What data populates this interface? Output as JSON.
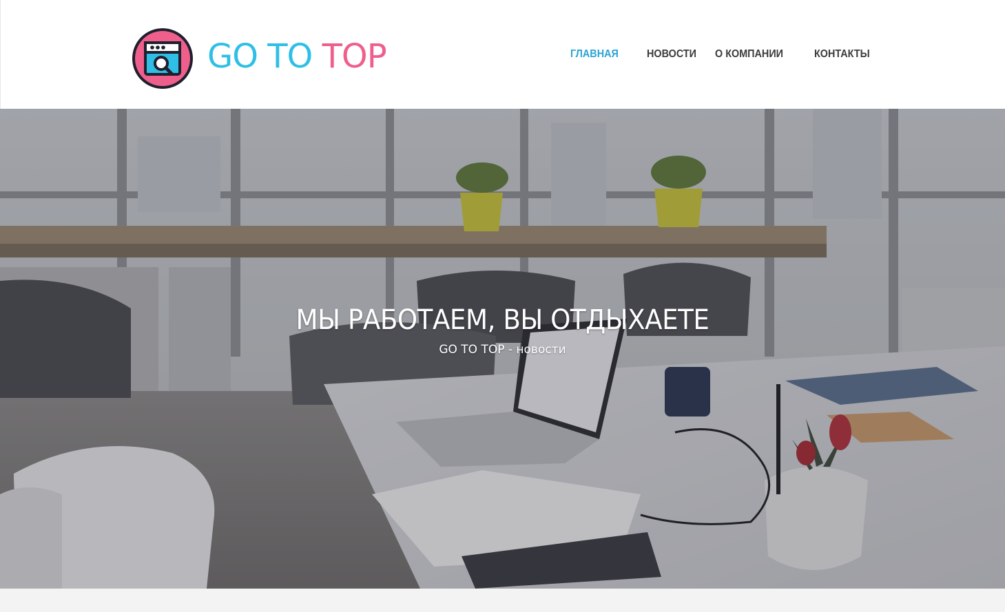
{
  "header": {
    "logo": {
      "word1": "GO TO",
      "word2": "TOP",
      "icon": "browser-search-icon"
    },
    "nav": [
      {
        "label": "ГЛАВНАЯ",
        "active": true
      },
      {
        "label": "НОВОСТИ",
        "active": false
      },
      {
        "label": "О КОМПАНИИ",
        "active": false
      },
      {
        "label": "КОНТАКТЫ",
        "active": false
      }
    ]
  },
  "hero": {
    "title": "МЫ РАБОТАЕМ, ВЫ ОТДЫХАЕТЕ",
    "subtitle": "GO TO TOP - новости",
    "background": "office-workspace-photo"
  },
  "colors": {
    "brand_blue": "#2fbfe6",
    "brand_pink": "#ef5f8c",
    "nav_active": "#2aa3d4",
    "nav_text": "#3b3b3b",
    "logo_outline": "#1f1f2e"
  }
}
